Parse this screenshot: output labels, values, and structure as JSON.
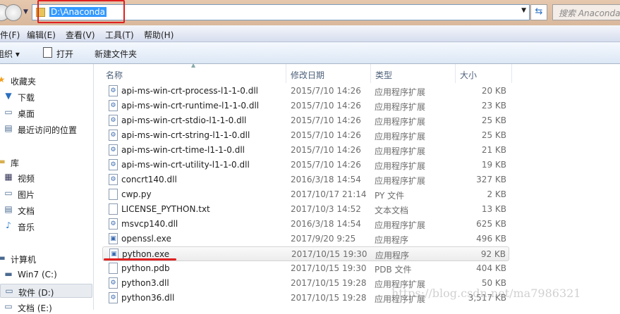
{
  "address": {
    "path": "D:\\Anaconda",
    "search_placeholder": "搜索 Anaconda"
  },
  "menu": [
    "件(F)",
    "编辑(E)",
    "查看(V)",
    "工具(T)",
    "帮助(H)"
  ],
  "toolbar": {
    "organize": "组织 ▾",
    "open": "打开",
    "new_folder": "新建文件夹"
  },
  "sidebar": [
    {
      "label": "收藏夹",
      "icon": "star-icon",
      "top": true
    },
    {
      "label": "下载",
      "icon": "download-folder-icon"
    },
    {
      "label": "桌面",
      "icon": "desktop-icon"
    },
    {
      "label": "最近访问的位置",
      "icon": "recent-places-icon"
    },
    {
      "label": "库",
      "icon": "library-icon",
      "top": true
    },
    {
      "label": "视频",
      "icon": "video-icon"
    },
    {
      "label": "图片",
      "icon": "picture-icon"
    },
    {
      "label": "文档",
      "icon": "document-icon"
    },
    {
      "label": "音乐",
      "icon": "music-icon"
    },
    {
      "label": "计算机",
      "icon": "computer-icon",
      "top": true
    },
    {
      "label": "Win7 (C:)",
      "icon": "system-drive-icon"
    },
    {
      "label": "软件 (D:)",
      "icon": "drive-icon",
      "selected": true
    },
    {
      "label": "文档 (E:)",
      "icon": "drive-icon"
    }
  ],
  "columns": {
    "name": "名称",
    "date": "修改日期",
    "type": "类型",
    "size": "大小"
  },
  "files": [
    {
      "name": "api-ms-win-crt-process-l1-1-0.dll",
      "date": "2015/7/10 14:26",
      "type": "应用程序扩展",
      "size": "20 KB"
    },
    {
      "name": "api-ms-win-crt-runtime-l1-1-0.dll",
      "date": "2015/7/10 14:26",
      "type": "应用程序扩展",
      "size": "23 KB"
    },
    {
      "name": "api-ms-win-crt-stdio-l1-1-0.dll",
      "date": "2015/7/10 14:26",
      "type": "应用程序扩展",
      "size": "25 KB"
    },
    {
      "name": "api-ms-win-crt-string-l1-1-0.dll",
      "date": "2015/7/10 14:26",
      "type": "应用程序扩展",
      "size": "25 KB"
    },
    {
      "name": "api-ms-win-crt-time-l1-1-0.dll",
      "date": "2015/7/10 14:26",
      "type": "应用程序扩展",
      "size": "21 KB"
    },
    {
      "name": "api-ms-win-crt-utility-l1-1-0.dll",
      "date": "2015/7/10 14:26",
      "type": "应用程序扩展",
      "size": "19 KB"
    },
    {
      "name": "concrt140.dll",
      "date": "2016/3/18 14:54",
      "type": "应用程序扩展",
      "size": "327 KB"
    },
    {
      "name": "cwp.py",
      "date": "2017/10/17 21:14",
      "type": "PY 文件",
      "size": "2 KB"
    },
    {
      "name": "LICENSE_PYTHON.txt",
      "date": "2017/10/3 14:52",
      "type": "文本文档",
      "size": "13 KB"
    },
    {
      "name": "msvcp140.dll",
      "date": "2016/3/18 14:54",
      "type": "应用程序扩展",
      "size": "625 KB"
    },
    {
      "name": "openssl.exe",
      "date": "2017/9/20 9:25",
      "type": "应用程序",
      "size": "496 KB"
    },
    {
      "name": "python.exe",
      "date": "2017/10/15 19:30",
      "type": "应用程序",
      "size": "92 KB",
      "selected": true
    },
    {
      "name": "python.pdb",
      "date": "2017/10/15 19:30",
      "type": "PDB 文件",
      "size": "404 KB"
    },
    {
      "name": "python3.dll",
      "date": "2017/10/15 19:28",
      "type": "应用程序扩展",
      "size": "50 KB"
    },
    {
      "name": "python36.dll",
      "date": "2017/10/15 19:28",
      "type": "应用程序扩展",
      "size": "3,517 KB"
    }
  ],
  "watermark": "https://blog.csdn.net/ma7986321"
}
